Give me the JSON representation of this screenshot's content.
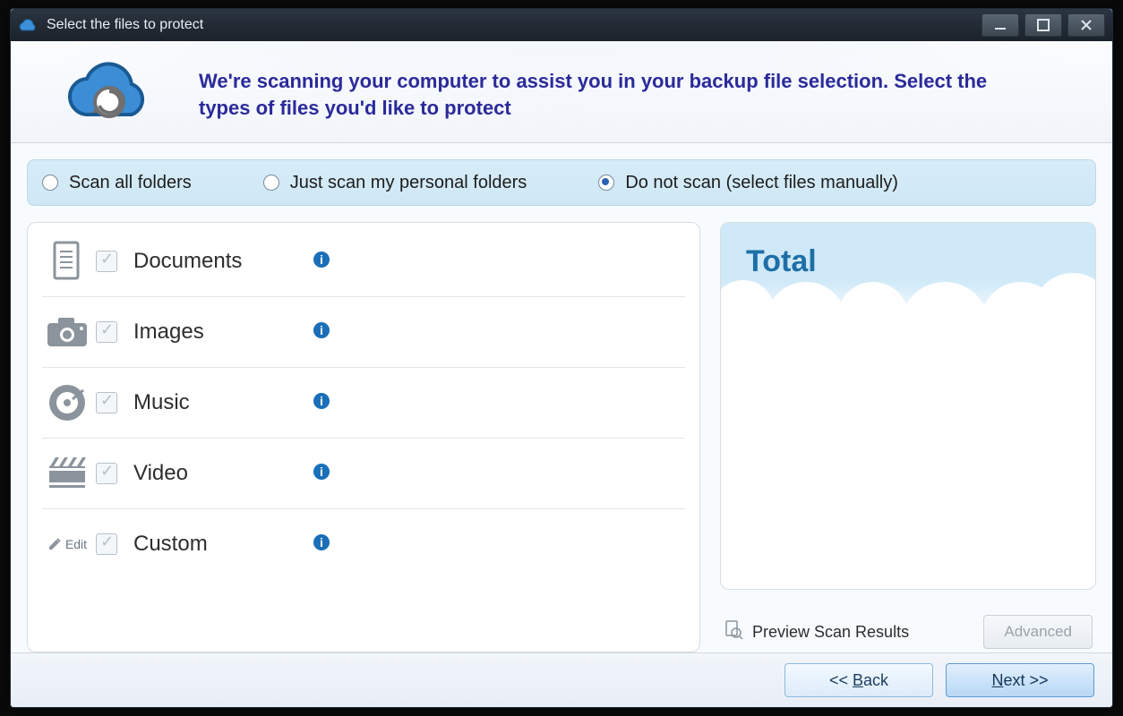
{
  "window": {
    "title": "Select the files to protect"
  },
  "header": {
    "message": "We're scanning your computer to assist you in your backup file selection. Select the types of files you'd like to protect"
  },
  "scan_options": {
    "selected": 2,
    "opts": [
      {
        "label": "Scan all folders"
      },
      {
        "label": "Just scan my personal folders"
      },
      {
        "label": "Do not scan (select files manually)"
      }
    ]
  },
  "file_types": [
    {
      "id": "documents",
      "label": "Documents",
      "edit": false
    },
    {
      "id": "images",
      "label": "Images",
      "edit": false
    },
    {
      "id": "music",
      "label": "Music",
      "edit": false
    },
    {
      "id": "video",
      "label": "Video",
      "edit": false
    },
    {
      "id": "custom",
      "label": "Custom",
      "edit": true,
      "edit_label": "Edit"
    }
  ],
  "total_panel": {
    "title": "Total"
  },
  "actions": {
    "preview": "Preview Scan Results",
    "advanced": "Advanced"
  },
  "footer": {
    "back": "<< Back",
    "back_key": "B",
    "next": "Next >>",
    "next_key": "N"
  }
}
